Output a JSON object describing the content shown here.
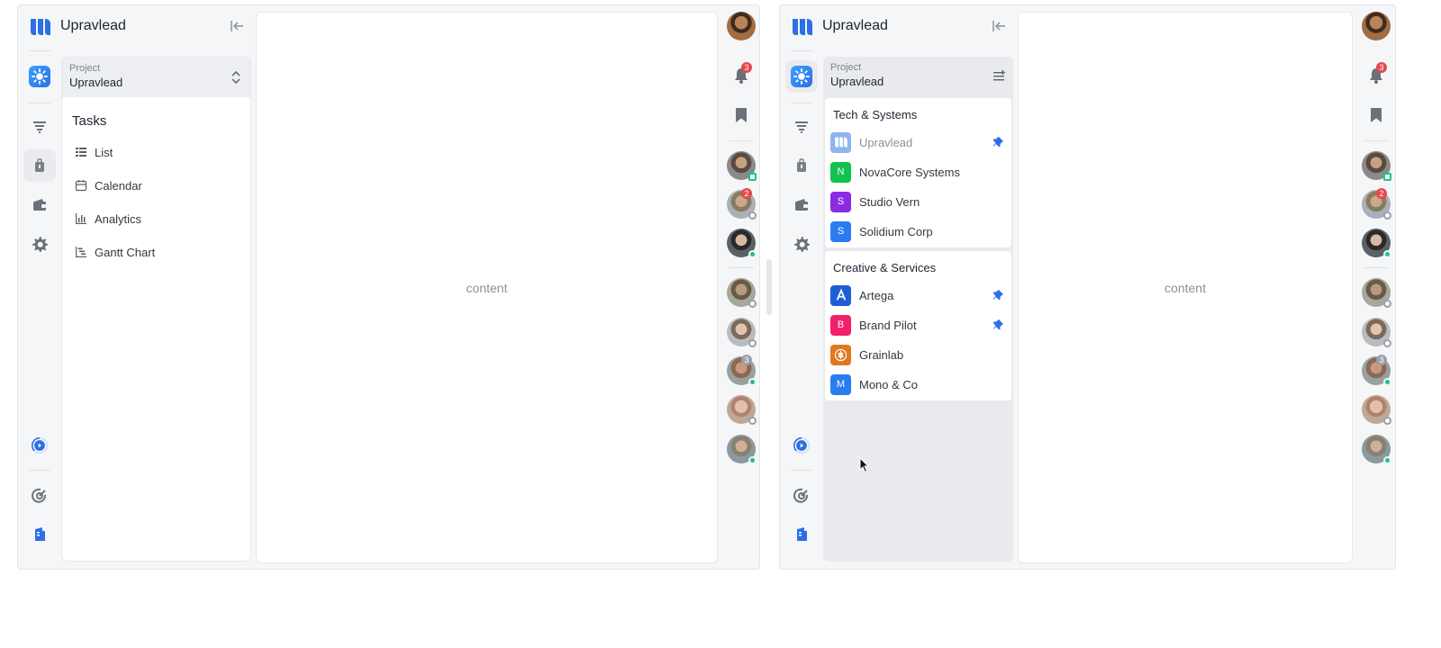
{
  "app": {
    "name": "Upravlead",
    "brand_color": "#2c6fe6"
  },
  "project_selector": {
    "label": "Project",
    "value": "Upravlead"
  },
  "tasks": {
    "title": "Tasks",
    "items": [
      {
        "label": "List",
        "icon": "list-icon"
      },
      {
        "label": "Calendar",
        "icon": "calendar-icon"
      },
      {
        "label": "Analytics",
        "icon": "analytics-icon"
      },
      {
        "label": "Gantt Chart",
        "icon": "gantt-icon"
      }
    ]
  },
  "content": {
    "placeholder": "content"
  },
  "notifications": {
    "count": "3"
  },
  "team": {
    "badges": {
      "member2": "2",
      "member6": "3"
    }
  },
  "project_dropdown": {
    "groups": [
      {
        "title": "Tech & Systems",
        "items": [
          {
            "label": "Upravlead",
            "letter": "",
            "color": "#8fb4f2",
            "pinned": true,
            "current": true
          },
          {
            "label": "NovaCore Systems",
            "letter": "N",
            "color": "#12c24f",
            "pinned": false
          },
          {
            "label": "Studio Vern",
            "letter": "S",
            "color": "#8a2be2",
            "pinned": false
          },
          {
            "label": "Solidium Corp",
            "letter": "S",
            "color": "#2a7df0",
            "pinned": false
          }
        ]
      },
      {
        "title": "Creative & Services",
        "items": [
          {
            "label": "Artega",
            "letter": "",
            "color": "#1f5fd6",
            "pinned": true
          },
          {
            "label": "Brand Pilot",
            "letter": "B",
            "color": "#f0206a",
            "pinned": true
          },
          {
            "label": "Grainlab",
            "letter": "",
            "color": "#e07a1f",
            "pinned": false
          },
          {
            "label": "Mono & Co",
            "letter": "M",
            "color": "#2a7df0",
            "pinned": false
          }
        ]
      }
    ]
  }
}
